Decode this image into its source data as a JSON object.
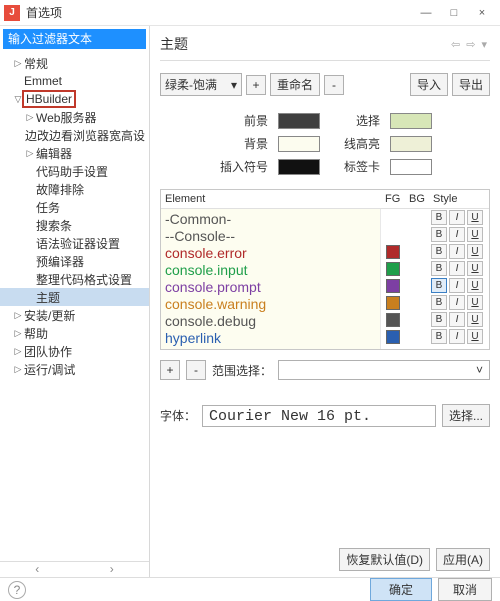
{
  "window": {
    "title": "首选项",
    "app_glyph": "J",
    "min": "—",
    "max": "□",
    "close": "×"
  },
  "sidebar": {
    "filter_placeholder": "输入过滤器文本",
    "items": [
      {
        "label": "常规",
        "indent": 1,
        "arrow": "▷"
      },
      {
        "label": "Emmet",
        "indent": 1,
        "arrow": ""
      },
      {
        "label": "HBuilder",
        "indent": 1,
        "arrow": "▽",
        "redbox": true
      },
      {
        "label": "Web服务器",
        "indent": 2,
        "arrow": "▷"
      },
      {
        "label": "边改边看浏览器宽高设",
        "indent": 2,
        "arrow": ""
      },
      {
        "label": "编辑器",
        "indent": 2,
        "arrow": "▷"
      },
      {
        "label": "代码助手设置",
        "indent": 2,
        "arrow": ""
      },
      {
        "label": "故障排除",
        "indent": 2,
        "arrow": ""
      },
      {
        "label": "任务",
        "indent": 2,
        "arrow": ""
      },
      {
        "label": "搜索条",
        "indent": 2,
        "arrow": ""
      },
      {
        "label": "语法验证器设置",
        "indent": 2,
        "arrow": ""
      },
      {
        "label": "预编译器",
        "indent": 2,
        "arrow": ""
      },
      {
        "label": "整理代码格式设置",
        "indent": 2,
        "arrow": ""
      },
      {
        "label": "主题",
        "indent": 2,
        "arrow": "",
        "selected": true
      },
      {
        "label": "安装/更新",
        "indent": 1,
        "arrow": "▷"
      },
      {
        "label": "帮助",
        "indent": 1,
        "arrow": "▷"
      },
      {
        "label": "团队协作",
        "indent": 1,
        "arrow": "▷"
      },
      {
        "label": "运行/调试",
        "indent": 1,
        "arrow": "▷"
      }
    ],
    "scroll_left": "‹",
    "scroll_right": "›"
  },
  "panel": {
    "title": "主题",
    "nav_back": "⇦",
    "nav_fwd": "⇨",
    "nav_menu": "▾",
    "theme_combo": "绿柔-饱满",
    "plus": "+",
    "rename": "重命名",
    "minus": "-",
    "import": "导入",
    "export": "导出",
    "color_rows": [
      {
        "l1": "前景",
        "c1": "#3f3f3f",
        "l2": "选择",
        "c2": "#d7e6b7"
      },
      {
        "l1": "背景",
        "c1": "#fcfcef",
        "l2": "线高亮",
        "c2": "#eef0d7"
      },
      {
        "l1": "插入符号",
        "c1": "#111111",
        "l2": "标签卡",
        "c2": "#ffffff"
      }
    ],
    "table_headers": {
      "element": "Element",
      "fg": "FG",
      "bg": "BG",
      "style": "Style"
    },
    "elements": [
      {
        "text": "-Common-",
        "color": "#555555",
        "fg": null,
        "style_b_sel": false
      },
      {
        "text": "--Console--",
        "color": "#555555",
        "fg": null,
        "style_b_sel": false
      },
      {
        "text": "console.error",
        "color": "#b02a2a",
        "fg": "#b02a2a",
        "style_b_sel": false
      },
      {
        "text": "console.input",
        "color": "#1f9e4a",
        "fg": "#1f9e4a",
        "style_b_sel": false
      },
      {
        "text": "console.prompt",
        "color": "#7d3fa3",
        "fg": "#7d3fa3",
        "style_b_sel": true
      },
      {
        "text": "console.warning",
        "color": "#c97f1f",
        "fg": "#c97f1f",
        "style_b_sel": false
      },
      {
        "text": "console.debug",
        "color": "#555555",
        "fg": "#555555",
        "style_b_sel": false
      },
      {
        "text": "hyperlink",
        "color": "#2a5fb0",
        "fg": "#2a5fb0",
        "style_b_sel": false
      }
    ],
    "style_b": "B",
    "style_i": "I",
    "style_u": "U",
    "range_label": "范围选择：",
    "font_label": "字体：",
    "font_value": "Courier New 16 pt.",
    "font_select": "选择...",
    "restore_default": "恢复默认值(D)",
    "apply": "应用(A)"
  },
  "footer": {
    "help": "?",
    "ok": "确定",
    "cancel": "取消"
  }
}
